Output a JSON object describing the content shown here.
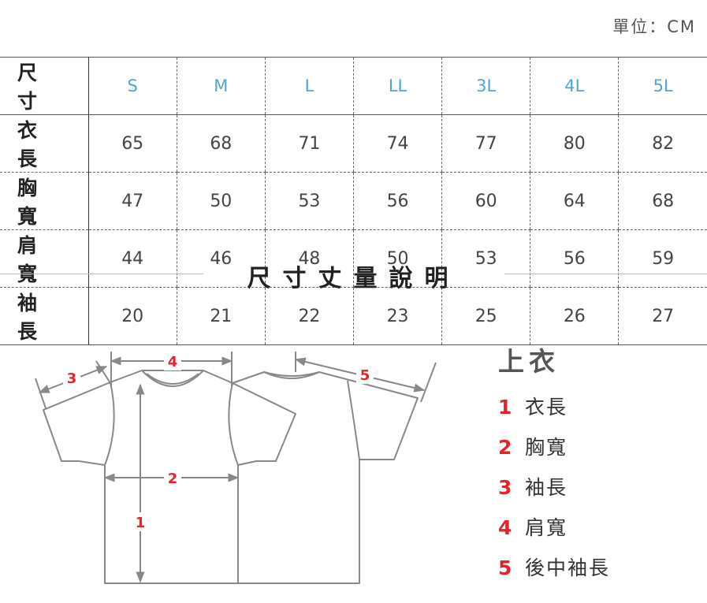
{
  "unit_label": "單位：CM",
  "table": {
    "header_label": "尺寸",
    "sizes": [
      "S",
      "M",
      "L",
      "LL",
      "3L",
      "4L",
      "5L"
    ],
    "rows": [
      {
        "label": "衣長",
        "values": [
          "65",
          "68",
          "71",
          "74",
          "77",
          "80",
          "82"
        ]
      },
      {
        "label": "胸寬",
        "values": [
          "47",
          "50",
          "53",
          "56",
          "60",
          "64",
          "68"
        ]
      },
      {
        "label": "肩寬",
        "values": [
          "44",
          "46",
          "48",
          "50",
          "53",
          "56",
          "59"
        ]
      },
      {
        "label": "袖長",
        "values": [
          "20",
          "21",
          "22",
          "23",
          "25",
          "26",
          "27"
        ]
      }
    ]
  },
  "section_title": "尺寸丈量說明",
  "diagram": {
    "markers": [
      "1",
      "2",
      "3",
      "4",
      "5"
    ],
    "colors": {
      "outline": "#888888",
      "marker": "#e3242b"
    }
  },
  "legend": {
    "title": "上衣",
    "items": [
      {
        "num": "1",
        "label": "衣長"
      },
      {
        "num": "2",
        "label": "胸寬"
      },
      {
        "num": "3",
        "label": "袖長"
      },
      {
        "num": "4",
        "label": "肩寬"
      },
      {
        "num": "5",
        "label": "後中袖長"
      }
    ]
  }
}
